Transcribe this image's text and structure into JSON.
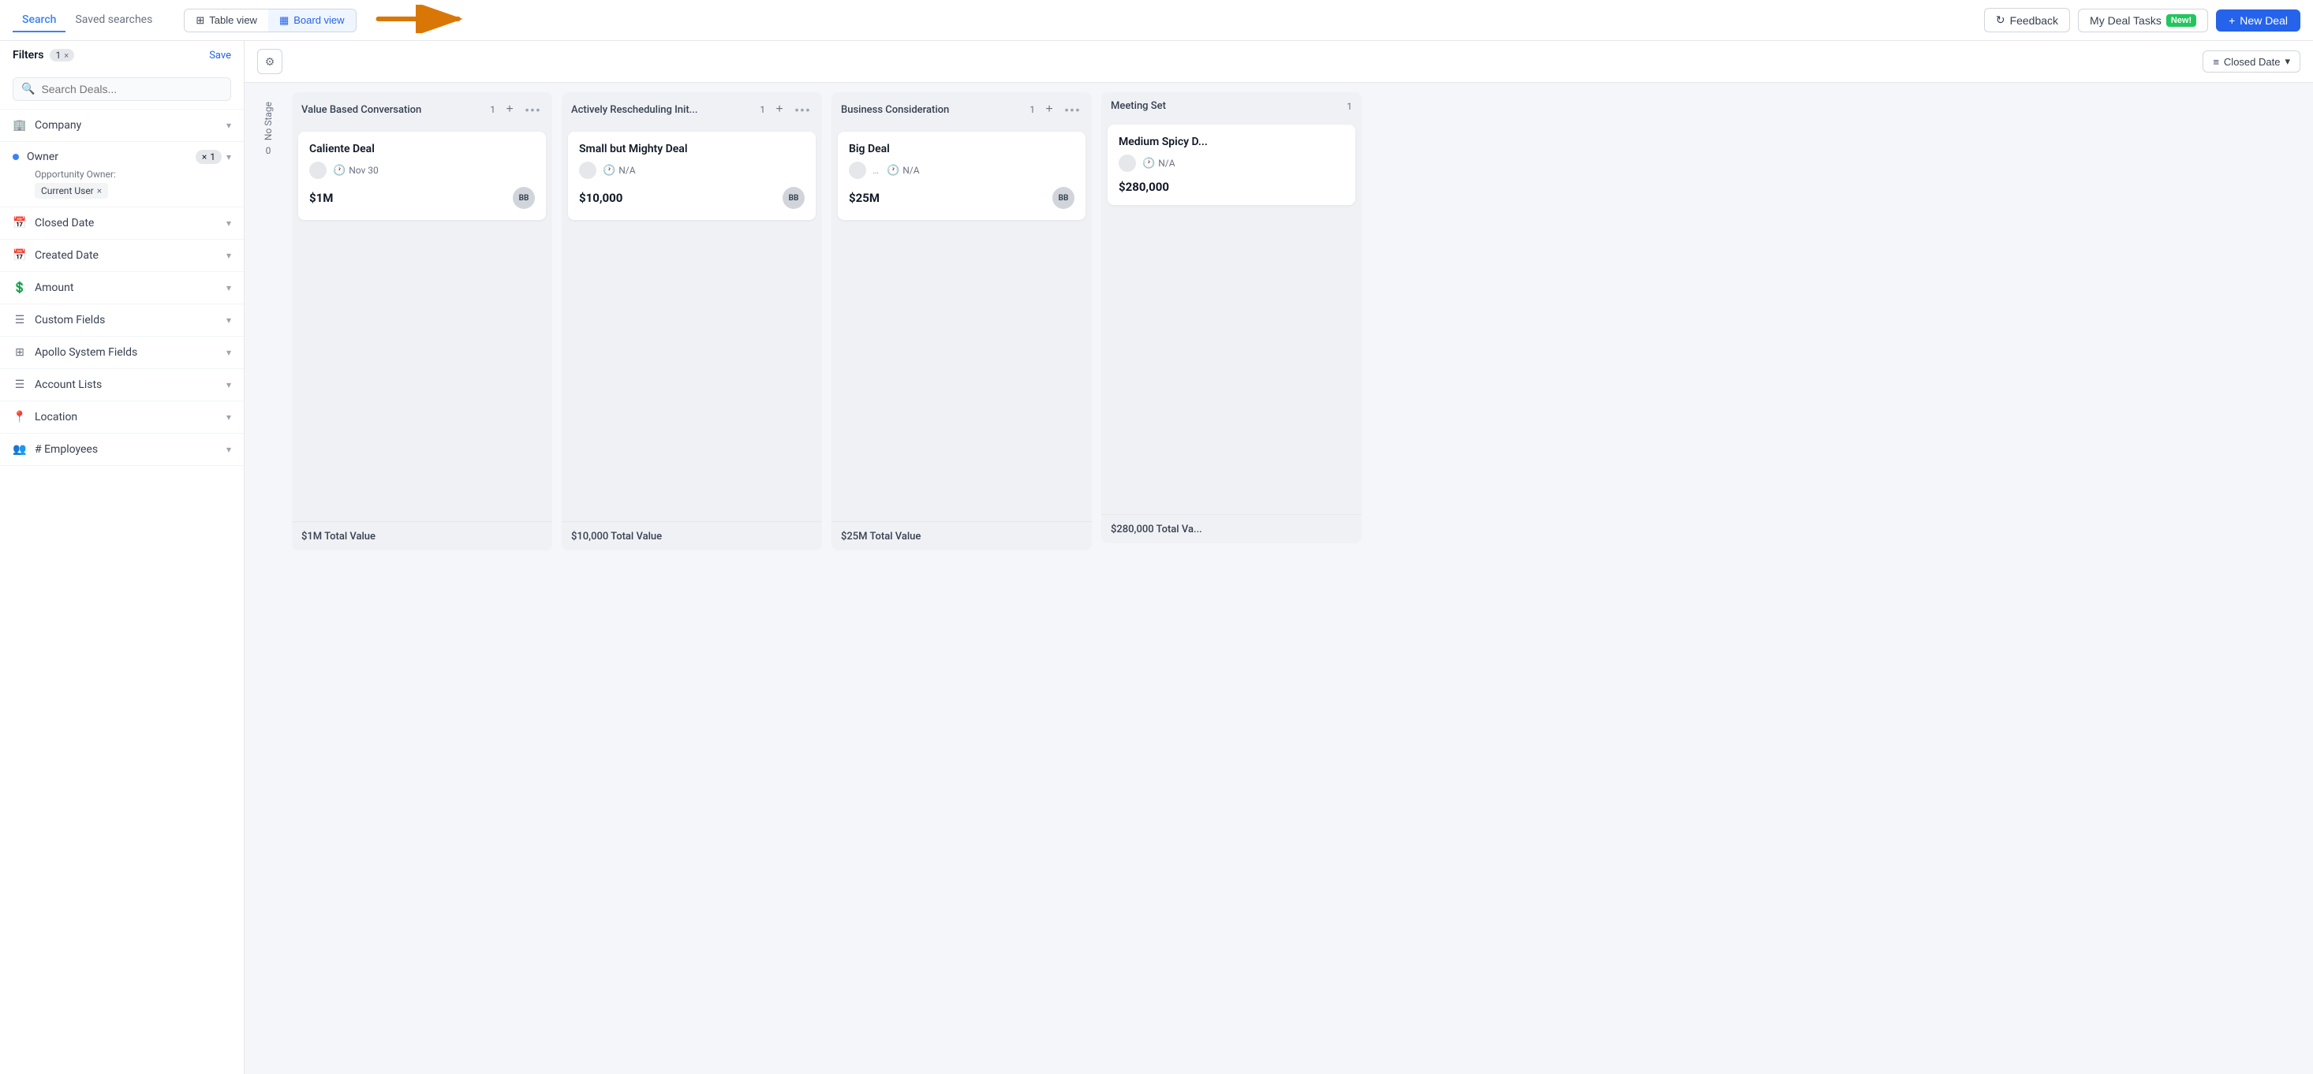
{
  "topbar": {
    "nav": {
      "search_label": "Search",
      "saved_searches_label": "Saved searches"
    },
    "views": {
      "table_label": "Table view",
      "board_label": "Board view"
    },
    "feedback_label": "Feedback",
    "my_deal_tasks_label": "My Deal Tasks",
    "new_badge_label": "New!",
    "new_deal_label": "New Deal"
  },
  "sidebar": {
    "search_placeholder": "Search Deals...",
    "filters_label": "Filters",
    "filter_count": "1",
    "save_label": "Save",
    "filters": [
      {
        "icon": "building",
        "label": "Company",
        "unicode": "🏢"
      },
      {
        "icon": "owner",
        "label": "Owner",
        "unicode": "👤",
        "is_owner": true,
        "badge_x": "×",
        "badge_num": "1",
        "sub_label": "Opportunity Owner:",
        "sub_tag": "Current User"
      },
      {
        "icon": "calendar",
        "label": "Closed Date",
        "unicode": "📅"
      },
      {
        "icon": "calendar2",
        "label": "Created Date",
        "unicode": "📅"
      },
      {
        "icon": "dollar",
        "label": "Amount",
        "unicode": "💲"
      },
      {
        "icon": "fields",
        "label": "Custom Fields",
        "unicode": "☰"
      },
      {
        "icon": "apollo",
        "label": "Apollo System Fields",
        "unicode": "⊞"
      },
      {
        "icon": "lists",
        "label": "Account Lists",
        "unicode": "☰"
      },
      {
        "icon": "location",
        "label": "Location",
        "unicode": "📍"
      },
      {
        "icon": "employees",
        "label": "# Employees",
        "unicode": "👥"
      }
    ]
  },
  "content_header": {
    "sort_label": "Closed Date"
  },
  "board": {
    "no_stage_label": "No Stage",
    "no_stage_count": "0",
    "columns": [
      {
        "id": "col1",
        "title": "Value Based Conversation",
        "count": 1,
        "cards": [
          {
            "name": "Caliente Deal",
            "date": "Nov 30",
            "amount": "$1M",
            "initials": "BB"
          }
        ],
        "total": "$1M Total Value"
      },
      {
        "id": "col2",
        "title": "Actively Rescheduling Init...",
        "count": 1,
        "cards": [
          {
            "name": "Small but Mighty Deal",
            "date": "N/A",
            "amount": "$10,000",
            "initials": "BB"
          }
        ],
        "total": "$10,000 Total Value"
      },
      {
        "id": "col3",
        "title": "Business Consideration",
        "count": 1,
        "cards": [
          {
            "name": "Big Deal",
            "date": "N/A",
            "amount": "$25M",
            "initials": "BB"
          }
        ],
        "total": "$25M Total Value"
      },
      {
        "id": "col4",
        "title": "Meeting Set",
        "count": 1,
        "cards": [
          {
            "name": "Medium Spicy D...",
            "date": "N/A",
            "amount": "$280,000",
            "initials": ""
          }
        ],
        "total": "$280,000 Total Va..."
      }
    ]
  }
}
